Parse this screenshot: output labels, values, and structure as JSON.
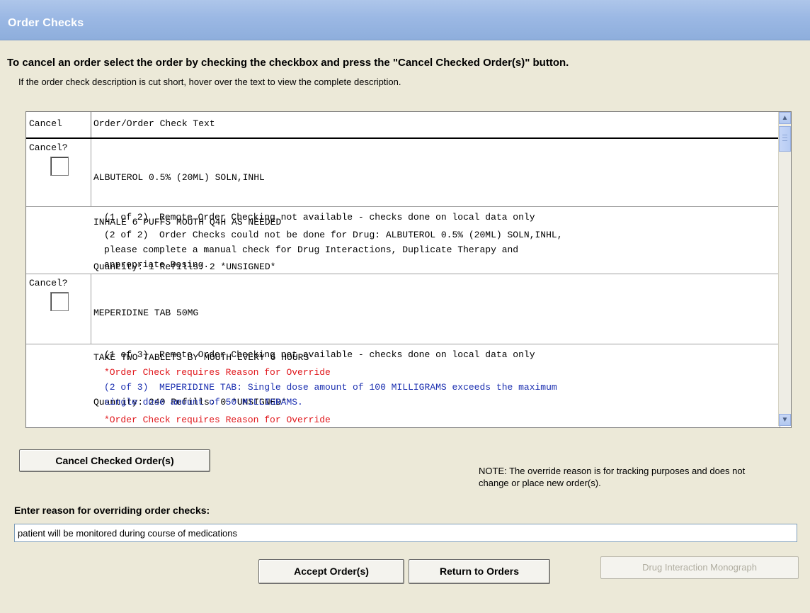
{
  "window": {
    "title": "Order Checks"
  },
  "instructions": {
    "main": "To cancel an order select the order by checking the checkbox and press the \"Cancel Checked Order(s)\" button.",
    "hint": "If the order check description is cut short, hover over the text to view the complete description."
  },
  "grid": {
    "columns": [
      "Cancel",
      "Order/Order Check Text"
    ],
    "cancel_label": "Cancel?",
    "orders": [
      {
        "lines": [
          "ALBUTEROL 0.5% (20ML) SOLN,INHL",
          "INHALE 6 PUFFS MOUTH Q4H AS NEEDED",
          "Quantity: 1 Refills: 2 *UNSIGNED*"
        ],
        "checks": [
          {
            "text": "(1 of 2)  Remote Order Checking not available - checks done on local data only",
            "color": "#000000"
          },
          {
            "text": "(2 of 2)  Order Checks could not be done for Drug: ALBUTEROL 0.5% (20ML) SOLN,INHL,",
            "color": "#000000"
          },
          {
            "text": "please complete a manual check for Drug Interactions, Duplicate Therapy and",
            "color": "#000000"
          },
          {
            "text": "appropriate Dosing.",
            "color": "#000000"
          }
        ]
      },
      {
        "lines": [
          "MEPERIDINE TAB 50MG",
          "TAKE TWO TABLETS BY MOUTH EVERY 6 HOURS",
          "Quantity: 240 Refills: 0 *UNSIGNED*"
        ],
        "checks": [
          {
            "text": "(1 of 3)  Remote Order Checking not available - checks done on local data only",
            "color": "#000000"
          },
          {
            "text": "*Order Check requires Reason for Override",
            "color": "#e0161b"
          },
          {
            "text": "(2 of 3)  MEPERIDINE TAB: Single dose amount of 100 MILLIGRAMS exceeds the maximum",
            "color": "#1b2fb0"
          },
          {
            "text": "single dose amount of 50 MILLIGRAMS.",
            "color": "#1b2fb0"
          },
          {
            "text": "*Order Check requires Reason for Override",
            "color": "#e0161b"
          }
        ]
      }
    ]
  },
  "buttons": {
    "cancel_checked": "Cancel Checked Order(s)",
    "accept": "Accept Order(s)",
    "return": "Return to Orders",
    "monograph": "Drug Interaction Monograph"
  },
  "note": "NOTE: The override reason is for tracking purposes and does not change or place new order(s).",
  "reason": {
    "label": "Enter reason for overriding order checks:",
    "value": "patient will be monitored during course of medications"
  },
  "colors": {
    "title_bar": "#9bb8e4",
    "override_red": "#e0161b",
    "check_blue": "#1b2fb0"
  },
  "icons": [
    "scroll-up-arrow-icon",
    "scroll-down-arrow-icon"
  ]
}
